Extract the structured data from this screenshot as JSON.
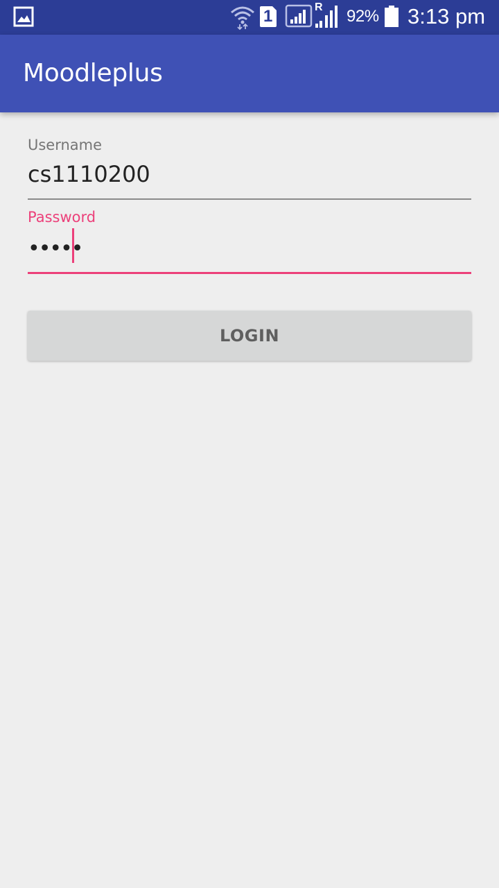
{
  "status_bar": {
    "battery_percent": "92%",
    "time": "3:13 pm",
    "sim_slot": "1",
    "roaming_indicator": "R",
    "icons": [
      "gallery-icon",
      "wifi-icon",
      "sim-1-icon",
      "signal-icon",
      "roaming-signal-icon",
      "battery-icon"
    ],
    "background_color": "#2c3d96"
  },
  "app_bar": {
    "title": "Moodleplus",
    "background_color": "#3f51b5"
  },
  "form": {
    "username": {
      "label": "Username",
      "value": "cs1110200"
    },
    "password": {
      "label": "Password",
      "value": "•••••",
      "focused": true,
      "accent_color": "#ec407a"
    },
    "login_button": {
      "label": "LOGIN"
    }
  }
}
